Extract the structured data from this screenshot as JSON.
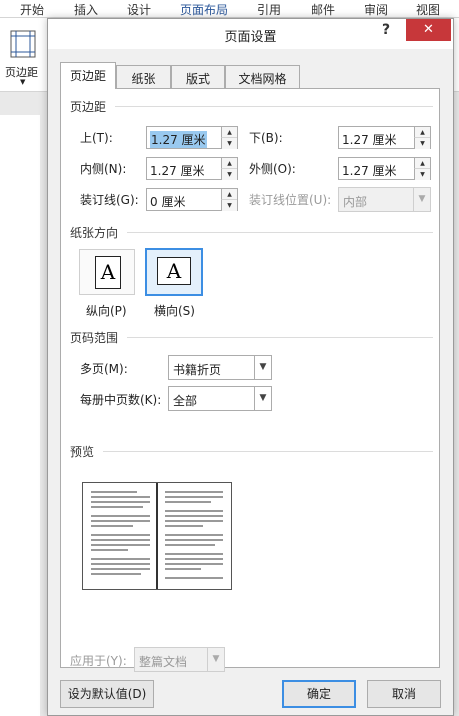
{
  "ribbon": {
    "tabs": [
      "开始",
      "插入",
      "设计",
      "页面布局",
      "引用",
      "邮件",
      "审阅",
      "视图"
    ],
    "active_tab": "页面布局",
    "margins_button": "页边距",
    "margins_more": "⋮"
  },
  "dialog": {
    "title": "页面设置",
    "help": "?",
    "close": "✕",
    "tabs": [
      "页边距",
      "纸张",
      "版式",
      "文档网格"
    ],
    "active_tab": "页边距",
    "margins": {
      "section_title": "页边距",
      "top_label": "上(T):",
      "top_value": "1.27 厘米",
      "bottom_label": "下(B):",
      "bottom_value": "1.27 厘米",
      "inside_label": "内侧(N):",
      "inside_value": "1.27 厘米",
      "outside_label": "外侧(O):",
      "outside_value": "1.27 厘米",
      "gutter_label": "装订线(G):",
      "gutter_value": "0 厘米",
      "gutter_pos_label": "装订线位置(U):",
      "gutter_pos_value": "内部"
    },
    "orientation": {
      "section_title": "纸张方向",
      "portrait_label": "纵向(P)",
      "landscape_label": "横向(S)",
      "glyph": "A",
      "selected": "landscape"
    },
    "pages": {
      "section_title": "页码范围",
      "multiple_label": "多页(M):",
      "multiple_value": "书籍折页",
      "sheets_label": "每册中页数(K):",
      "sheets_value": "全部"
    },
    "preview": {
      "section_title": "预览",
      "apply_label": "应用于(Y):",
      "apply_value": "整篇文档"
    },
    "buttons": {
      "set_default": "设为默认值(D)",
      "ok": "确定",
      "cancel": "取消"
    }
  },
  "colors": {
    "accent": "#2b579a",
    "close": "#c7373a",
    "selection_border": "#3c8ee3",
    "text_selection": "#99c9ef"
  }
}
